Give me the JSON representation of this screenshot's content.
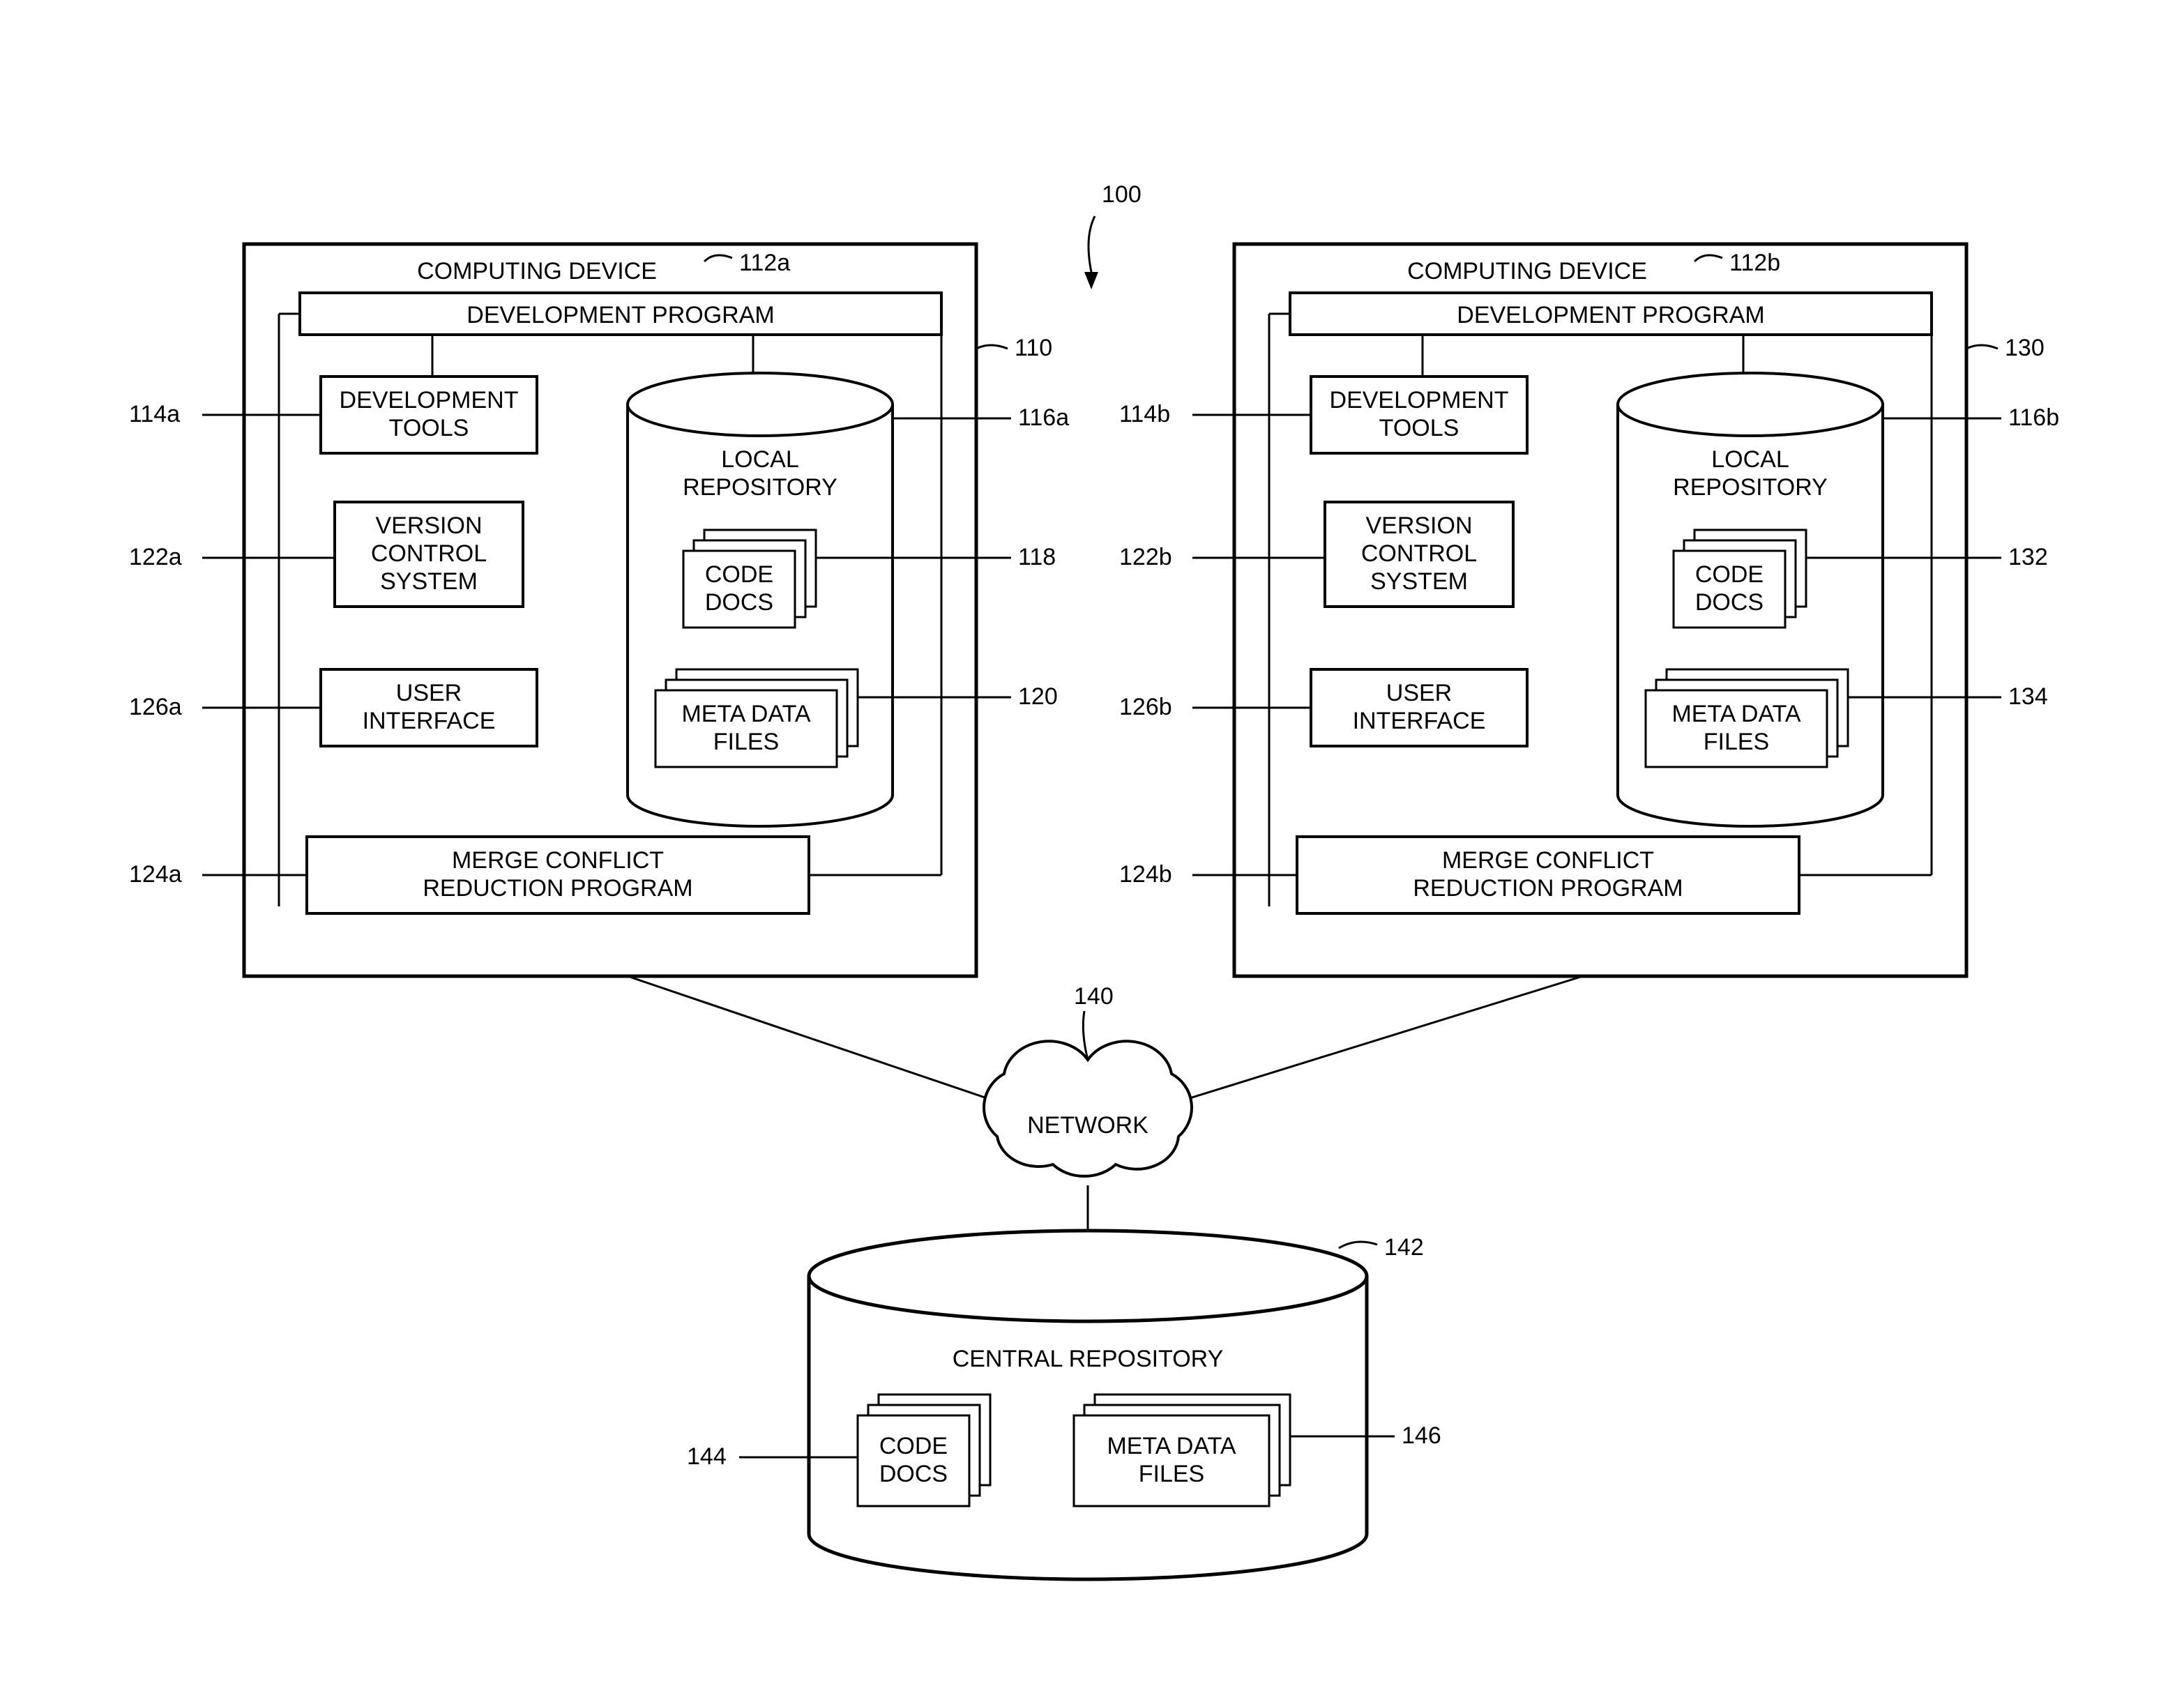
{
  "refs": {
    "r100": "100",
    "r110": "110",
    "r112a": "112a",
    "r114a": "114a",
    "r116a": "116a",
    "r118": "118",
    "r120": "120",
    "r122a": "122a",
    "r124a": "124a",
    "r126a": "126a",
    "r130": "130",
    "r112b": "112b",
    "r114b": "114b",
    "r116b": "116b",
    "r122b": "122b",
    "r124b": "124b",
    "r126b": "126b",
    "r132": "132",
    "r134": "134",
    "r140": "140",
    "r142": "142",
    "r144": "144",
    "r146": "146"
  },
  "labels": {
    "computing_device": "COMPUTING DEVICE",
    "development_program": "DEVELOPMENT PROGRAM",
    "development_tools_l1": "DEVELOPMENT",
    "development_tools_l2": "TOOLS",
    "version_control_l1": "VERSION",
    "version_control_l2": "CONTROL",
    "version_control_l3": "SYSTEM",
    "user_interface_l1": "USER",
    "user_interface_l2": "INTERFACE",
    "merge_conflict_l1": "MERGE CONFLICT",
    "merge_conflict_l2": "REDUCTION PROGRAM",
    "local_repo_l1": "LOCAL",
    "local_repo_l2": "REPOSITORY",
    "code_docs_l1": "CODE",
    "code_docs_l2": "DOCS",
    "meta_data_l1": "META DATA",
    "meta_data_l2": "FILES",
    "network": "NETWORK",
    "central_repo": "CENTRAL REPOSITORY"
  }
}
